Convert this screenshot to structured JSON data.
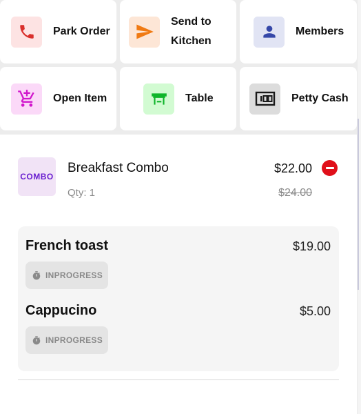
{
  "actions": [
    {
      "label": "Park Order",
      "icon": "phone-icon",
      "bg": "#fde3e3",
      "color": "#d9302c"
    },
    {
      "label": "Send to Kitchen",
      "icon": "send-icon",
      "bg": "#fde6d6",
      "color": "#f07a13"
    },
    {
      "label": "Members",
      "icon": "person-icon",
      "bg": "#e1e4f4",
      "color": "#3547a8"
    },
    {
      "label": "Open Item",
      "icon": "cart-plus-icon",
      "bg": "#fbd9f8",
      "color": "#d117cc"
    },
    {
      "label": "Table",
      "icon": "table-icon",
      "bg": "#d2fbd2",
      "color": "#0fb52a"
    },
    {
      "label": "Petty Cash",
      "icon": "cash-icon",
      "bg": "#dcdcdc",
      "color": "#1a1a1a"
    }
  ],
  "order": {
    "badge": "COMBO",
    "name": "Breakfast Combo",
    "qty": "Qty: 1",
    "price": "$22.00",
    "old_price": "$24.00",
    "remove_color": "#e0101a",
    "sub_items": [
      {
        "name": "French toast",
        "price": "$19.00",
        "status": "INPROGRESS"
      },
      {
        "name": "Cappucino",
        "price": "$5.00",
        "status": "INPROGRESS"
      }
    ]
  }
}
